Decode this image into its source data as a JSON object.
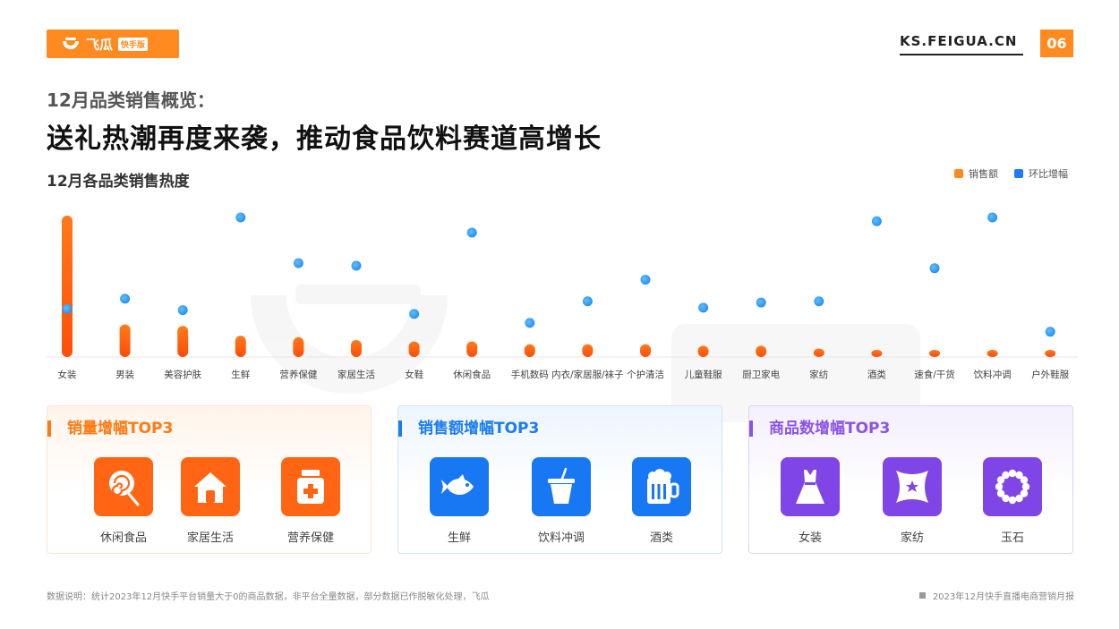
{
  "brand": {
    "logo_text": "飞瓜",
    "logo_badge": "快手版",
    "site": "KS.FEIGUA.CN",
    "page": "06"
  },
  "header": {
    "subtitle": "12月品类销售概览：",
    "title": "送礼热潮再度来袭，推动食品饮料赛道高增长"
  },
  "colors": {
    "orange": "#ff8a1f",
    "blue": "#1c7cf4",
    "purple": "#8a53e8"
  },
  "chart_data": {
    "type": "bar",
    "title": "12月各品类销售热度",
    "categories": [
      "女装",
      "男装",
      "美容护肤",
      "生鲜",
      "营养保健",
      "家居生活",
      "女鞋",
      "休闲食品",
      "手机数码",
      "内衣/家居服/袜子",
      "个护清洁",
      "儿童鞋服",
      "厨卫家电",
      "家纺",
      "酒类",
      "速食/干货",
      "饮料冲调",
      "户外鞋服"
    ],
    "series": [
      {
        "name": "销售额",
        "kind": "bar",
        "color": "#ff6a12",
        "values": [
          100,
          23,
          22,
          15,
          14,
          12,
          11,
          11,
          9,
          9,
          9,
          8,
          8,
          6,
          5,
          4,
          4,
          3
        ]
      },
      {
        "name": "环比增幅",
        "kind": "dot",
        "color": "#3aa7f5",
        "values": [
          28,
          36,
          27,
          100,
          64,
          62,
          24,
          88,
          17,
          34,
          51,
          29,
          33,
          34,
          97,
          60,
          100,
          10
        ]
      }
    ],
    "ylim": [
      0,
      100
    ],
    "legend": "top-right",
    "grid": false
  },
  "panels": [
    {
      "title": "销量增幅TOP3",
      "items": [
        {
          "label": "休闲食品",
          "icon": "lollipop-icon"
        },
        {
          "label": "家居生活",
          "icon": "house-icon"
        },
        {
          "label": "营养保健",
          "icon": "medicine-bottle-icon"
        }
      ]
    },
    {
      "title": "销售额增幅TOP3",
      "items": [
        {
          "label": "生鲜",
          "icon": "fish-icon"
        },
        {
          "label": "饮料冲调",
          "icon": "drink-cup-icon"
        },
        {
          "label": "酒类",
          "icon": "beer-mug-icon"
        }
      ]
    },
    {
      "title": "商品数增幅TOP3",
      "items": [
        {
          "label": "女装",
          "icon": "dress-icon"
        },
        {
          "label": "家纺",
          "icon": "pillow-icon"
        },
        {
          "label": "玉石",
          "icon": "bead-bracelet-icon"
        }
      ]
    }
  ],
  "footer": {
    "note": "数据说明：统计2023年12月快手平台销量大于0的商品数据，非平台全量数据，部分数据已作脱敏化处理，飞瓜",
    "report": "2023年12月快手直播电商营销月报"
  }
}
